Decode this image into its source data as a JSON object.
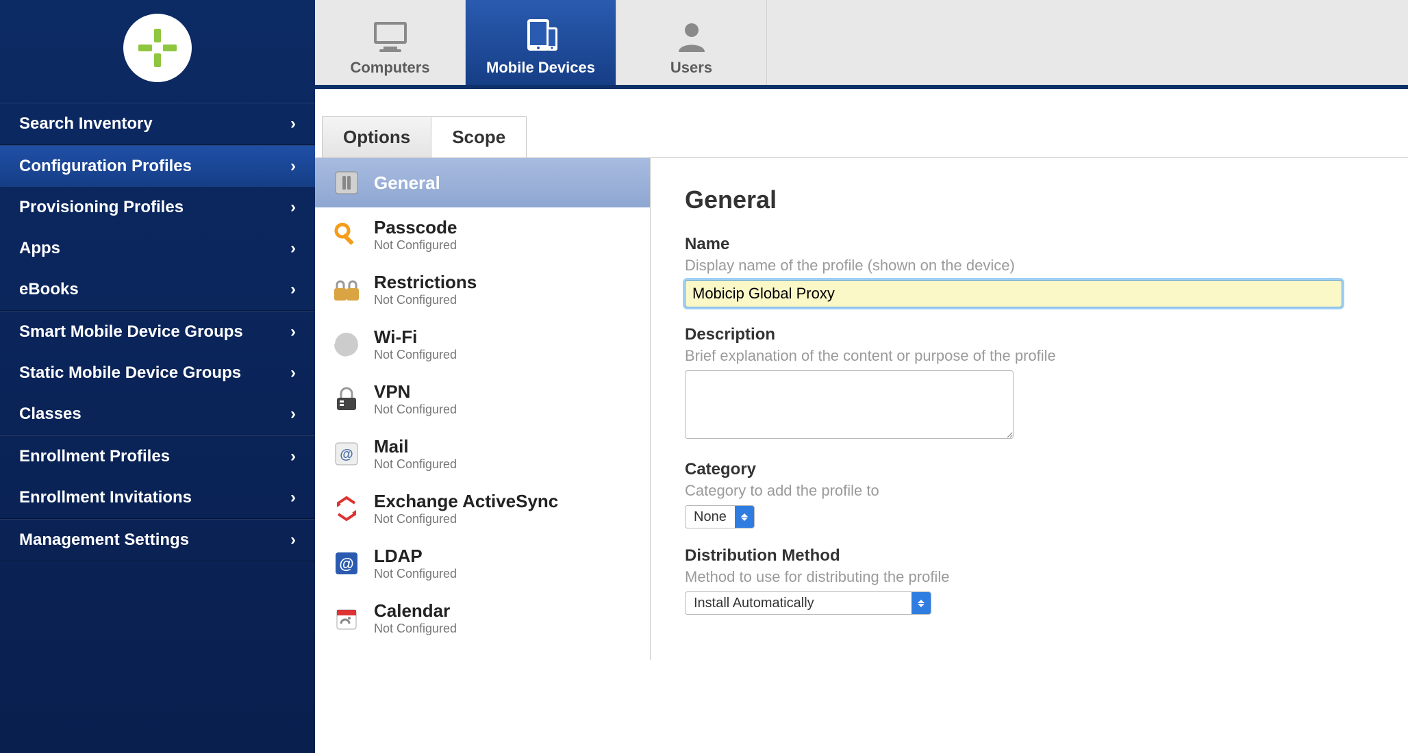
{
  "sidebar": {
    "groups": [
      {
        "items": [
          {
            "label": "Search Inventory",
            "active": false
          }
        ]
      },
      {
        "items": [
          {
            "label": "Configuration Profiles",
            "active": true
          },
          {
            "label": "Provisioning Profiles",
            "active": false
          },
          {
            "label": "Apps",
            "active": false
          },
          {
            "label": "eBooks",
            "active": false
          }
        ]
      },
      {
        "items": [
          {
            "label": "Smart Mobile Device Groups",
            "active": false
          },
          {
            "label": "Static Mobile Device Groups",
            "active": false
          },
          {
            "label": "Classes",
            "active": false
          }
        ]
      },
      {
        "items": [
          {
            "label": "Enrollment Profiles",
            "active": false
          },
          {
            "label": "Enrollment Invitations",
            "active": false
          }
        ]
      },
      {
        "items": [
          {
            "label": "Management Settings",
            "active": false
          }
        ]
      }
    ]
  },
  "toptabs": {
    "computers": "Computers",
    "mobile_devices": "Mobile Devices",
    "users": "Users"
  },
  "subtabs": {
    "options": "Options",
    "scope": "Scope"
  },
  "payloads": [
    {
      "title": "General",
      "sub": "",
      "icon": "general-icon"
    },
    {
      "title": "Passcode",
      "sub": "Not Configured",
      "icon": "key-icon"
    },
    {
      "title": "Restrictions",
      "sub": "Not Configured",
      "icon": "lock-icon"
    },
    {
      "title": "Wi-Fi",
      "sub": "Not Configured",
      "icon": "wifi-icon"
    },
    {
      "title": "VPN",
      "sub": "Not Configured",
      "icon": "vpn-icon"
    },
    {
      "title": "Mail",
      "sub": "Not Configured",
      "icon": "mail-icon"
    },
    {
      "title": "Exchange ActiveSync",
      "sub": "Not Configured",
      "icon": "exchange-icon"
    },
    {
      "title": "LDAP",
      "sub": "Not Configured",
      "icon": "ldap-icon"
    },
    {
      "title": "Calendar",
      "sub": "Not Configured",
      "icon": "calendar-icon"
    }
  ],
  "detail": {
    "heading": "General",
    "name_label": "Name",
    "name_help": "Display name of the profile (shown on the device)",
    "name_value": "Mobicip Global Proxy",
    "desc_label": "Description",
    "desc_help": "Brief explanation of the content or purpose of the profile",
    "desc_value": "",
    "category_label": "Category",
    "category_help": "Category to add the profile to",
    "category_value": "None",
    "dist_label": "Distribution Method",
    "dist_help": "Method to use for distributing the profile",
    "dist_value": "Install Automatically"
  }
}
